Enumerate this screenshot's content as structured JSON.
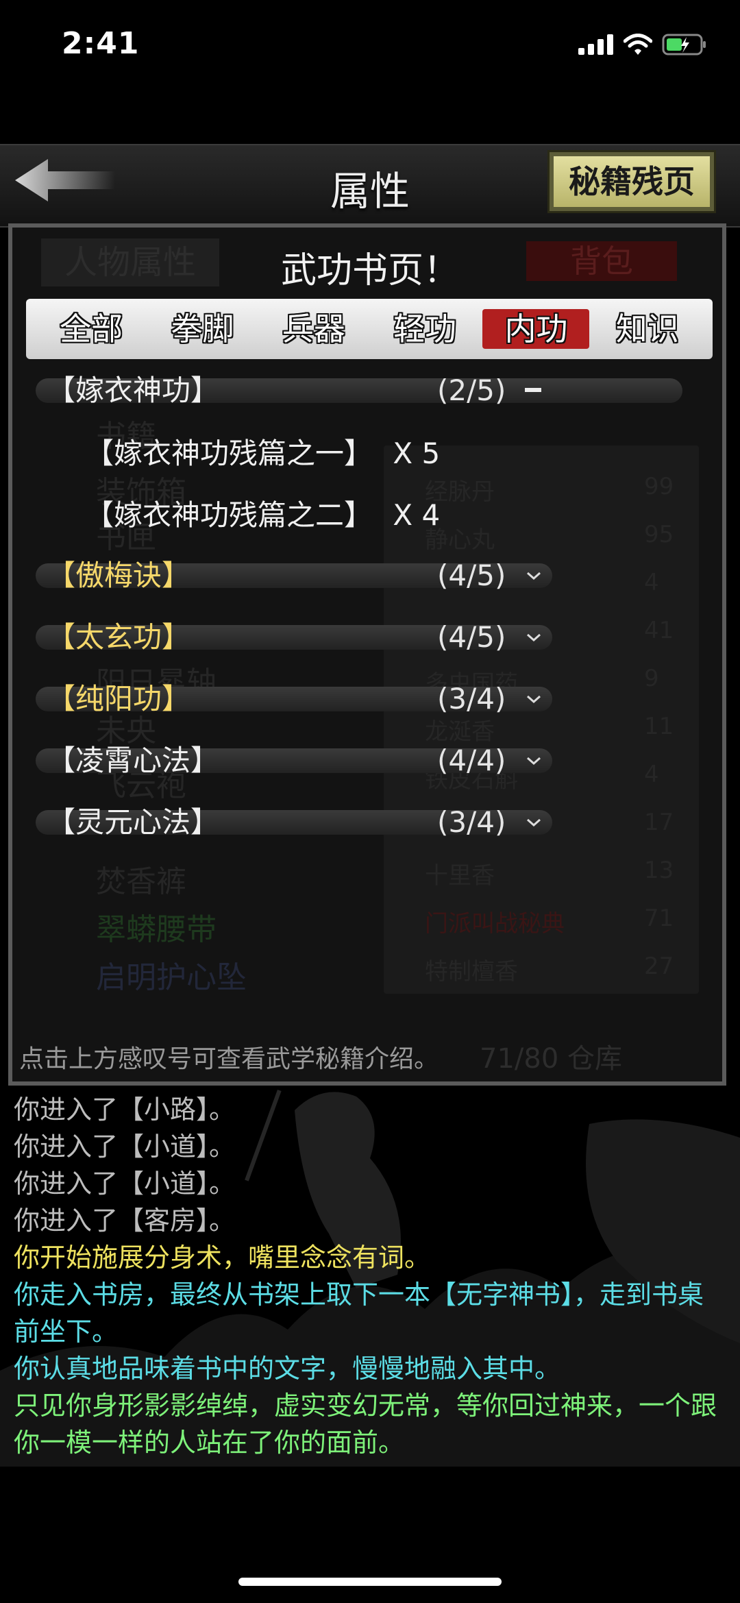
{
  "status_bar": {
    "time": "2:41"
  },
  "header": {
    "title": "属性",
    "secret_button": "秘籍残页"
  },
  "background_panel": {
    "left_tab": "人物属性",
    "right_tab": "背包",
    "left_items": [
      "书籍",
      "装饰箱",
      "书匣",
      "",
      "",
      "阳日晷轴",
      "未央",
      "飞云袍",
      "",
      "焚香裤",
      "翠蟒腰带",
      "启明护心坠"
    ],
    "right_items": [
      {
        "name": "经脉丹",
        "count": "99"
      },
      {
        "name": "静心丸",
        "count": "95"
      },
      {
        "name": "",
        "count": "4"
      },
      {
        "name": "",
        "count": "41"
      },
      {
        "name": "多虫国药",
        "count": "9"
      },
      {
        "name": "龙涎香",
        "count": "11"
      },
      {
        "name": "铁皮石斛",
        "count": "4"
      },
      {
        "name": "",
        "count": "17"
      },
      {
        "name": "十里香",
        "count": "13"
      },
      {
        "name": "门派叫战秘典",
        "count": "71"
      },
      {
        "name": "特制檀香",
        "count": "27"
      }
    ],
    "storage": "71/80 仓库"
  },
  "dialog": {
    "title": "武功书页！",
    "tabs": [
      {
        "label": "全部",
        "active": false
      },
      {
        "label": "拳脚",
        "active": false
      },
      {
        "label": "兵器",
        "active": false
      },
      {
        "label": "轻功",
        "active": false
      },
      {
        "label": "内功",
        "active": true
      },
      {
        "label": "知识",
        "active": false
      }
    ],
    "skills": [
      {
        "name": "【嫁衣神功】",
        "count": "(2/5)",
        "color": "white",
        "expanded": true
      },
      {
        "name": "【傲梅诀】",
        "count": "(4/5)",
        "color": "yellow",
        "expanded": false
      },
      {
        "name": "【太玄功】",
        "count": "(4/5)",
        "color": "yellow",
        "expanded": false
      },
      {
        "name": "【纯阳功】",
        "count": "(3/4)",
        "color": "yellow",
        "expanded": false
      },
      {
        "name": "【凌霄心法】",
        "count": "(4/4)",
        "color": "white",
        "expanded": false
      },
      {
        "name": "【灵元心法】",
        "count": "(3/4)",
        "color": "white",
        "expanded": false
      }
    ],
    "sub_items": [
      {
        "name": "【嫁衣神功残篇之一】",
        "qty": "X 5"
      },
      {
        "name": "【嫁衣神功残篇之二】",
        "qty": "X 4"
      }
    ],
    "hint": "点击上方感叹号可查看武学秘籍介绍。"
  },
  "log": [
    {
      "text": "你进入了【小路】。",
      "color": "gray"
    },
    {
      "text": "你进入了【小道】。",
      "color": "gray"
    },
    {
      "text": "你进入了【小道】。",
      "color": "gray"
    },
    {
      "text": "你进入了【客房】。",
      "color": "gray"
    },
    {
      "text": "你开始施展分身术，嘴里念念有词。",
      "color": "yellow"
    },
    {
      "text": "你走入书房，最终从书架上取下一本【无字神书】，走到书桌前坐下。",
      "color": "cyan"
    },
    {
      "text": "你认真地品味着书中的文字，慢慢地融入其中。",
      "color": "cyan"
    },
    {
      "text": "只见你身形影影绰绰，虚实变幻无常，等你回过神来，一个跟你一模一样的人站在了你的面前。",
      "color": "green"
    }
  ],
  "colors": {
    "active_tab": "#b11f1f",
    "yellow_text": "#f6d86a",
    "secret_button": "#d8d48c"
  }
}
